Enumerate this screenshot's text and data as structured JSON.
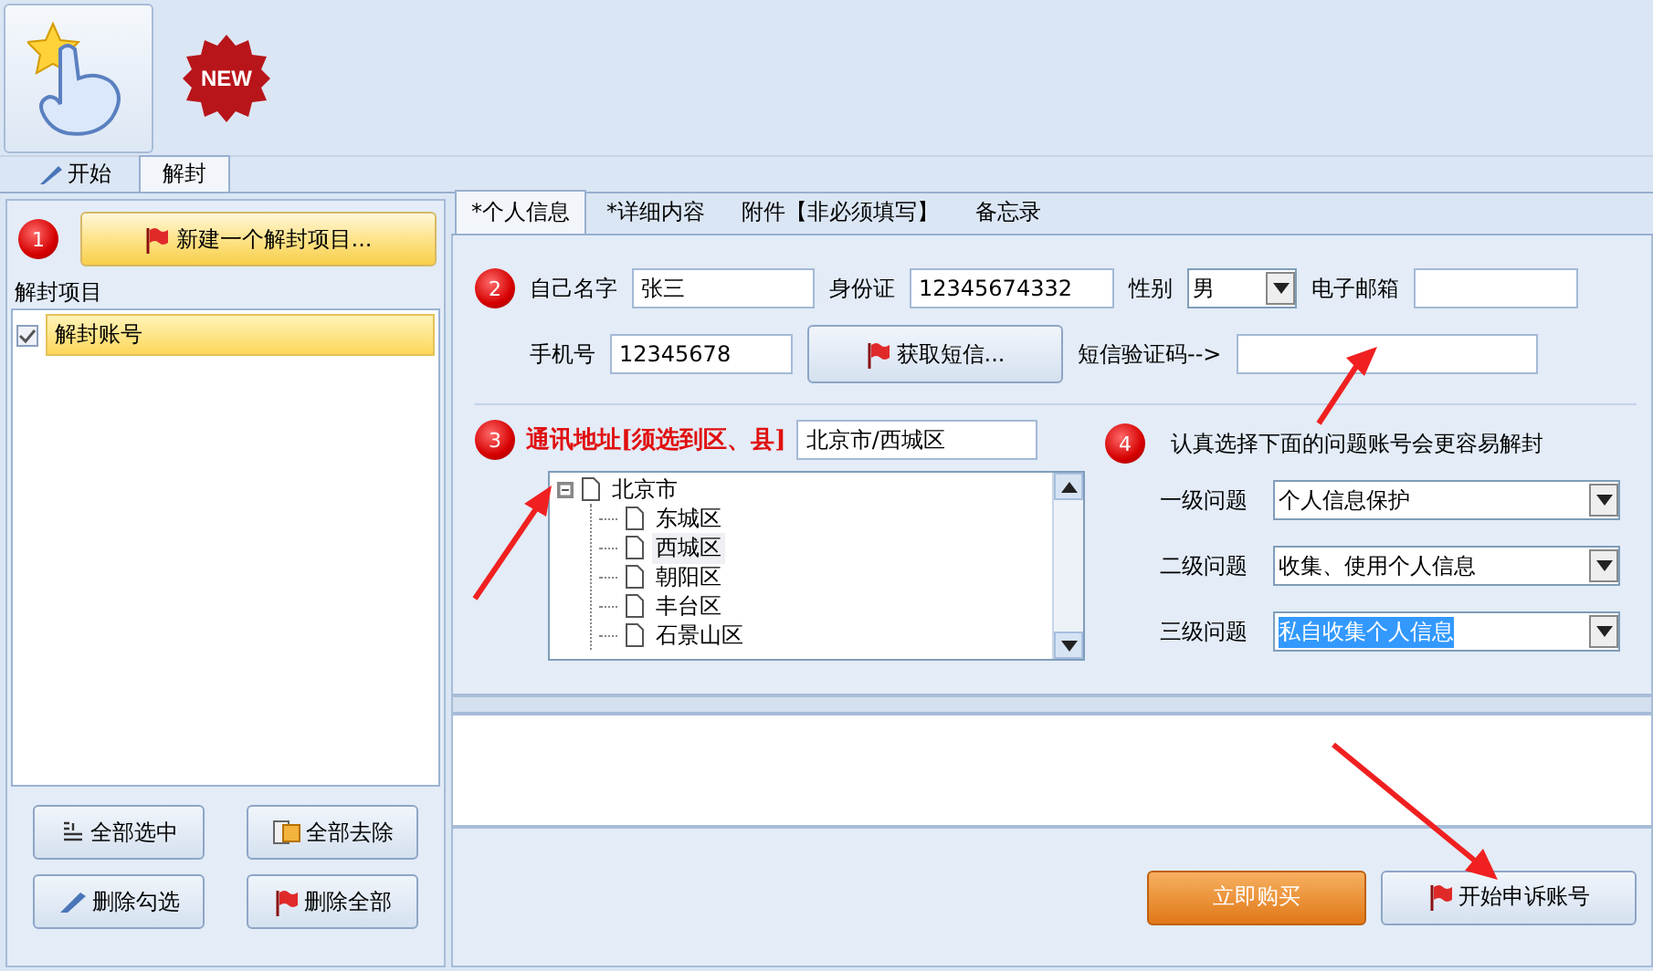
{
  "toolbar": {
    "new_badge": "NEW"
  },
  "main_tabs": [
    {
      "label": "开始",
      "selected": false
    },
    {
      "label": "解封",
      "selected": true
    }
  ],
  "left": {
    "step": "1",
    "new_button": "新建一个解封项目...",
    "group_label": "解封项目",
    "items": [
      {
        "label": "解封账号",
        "checked": true,
        "selected": true
      }
    ],
    "buttons": [
      {
        "label": "全部选中",
        "kind": "lines"
      },
      {
        "label": "全部去除",
        "kind": "clear"
      },
      {
        "label": "删除勾选",
        "kind": "pen"
      },
      {
        "label": "删除全部",
        "kind": "flag"
      }
    ]
  },
  "right": {
    "tabs": [
      {
        "label": "*个人信息",
        "selected": true
      },
      {
        "label": "*详细内容",
        "selected": false
      },
      {
        "label": "附件【非必须填写】",
        "selected": false
      },
      {
        "label": "备忘录",
        "selected": false
      }
    ],
    "step2": "2",
    "name": {
      "label": "自己名字",
      "value": "张三"
    },
    "id_card": {
      "label": "身份证",
      "value": "12345674332"
    },
    "gender": {
      "label": "性别",
      "value": "男"
    },
    "email": {
      "label": "电子邮箱"
    },
    "phone": {
      "label": "手机号",
      "value": "12345678"
    },
    "sms_button": "获取短信...",
    "code": {
      "label": "短信验证码-->"
    },
    "step3": "3",
    "address": {
      "label": "通讯地址[须选到区、县]",
      "value": "北京市/西城区"
    },
    "tree": [
      {
        "label": "北京市",
        "expanded": true,
        "selected": false,
        "children": [
          {
            "label": "东城区",
            "selected": false
          },
          {
            "label": "西城区",
            "selected": true
          },
          {
            "label": "朝阳区",
            "selected": false
          },
          {
            "label": "丰台区",
            "selected": false
          },
          {
            "label": "石景山区",
            "selected": false
          }
        ]
      }
    ],
    "step4": "4",
    "hint": "认真选择下面的问题账号会更容易解封",
    "questions": [
      {
        "label": "一级问题",
        "value": "个人信息保护",
        "selected": false
      },
      {
        "label": "二级问题",
        "value": "收集、使用个人信息",
        "selected": false
      },
      {
        "label": "三级问题",
        "value": "私自收集个人信息",
        "selected": true
      }
    ],
    "bottom_buttons": [
      {
        "label": "立即购买",
        "kind": "primary"
      },
      {
        "label": "开始申诉账号",
        "kind": "flag"
      }
    ]
  }
}
